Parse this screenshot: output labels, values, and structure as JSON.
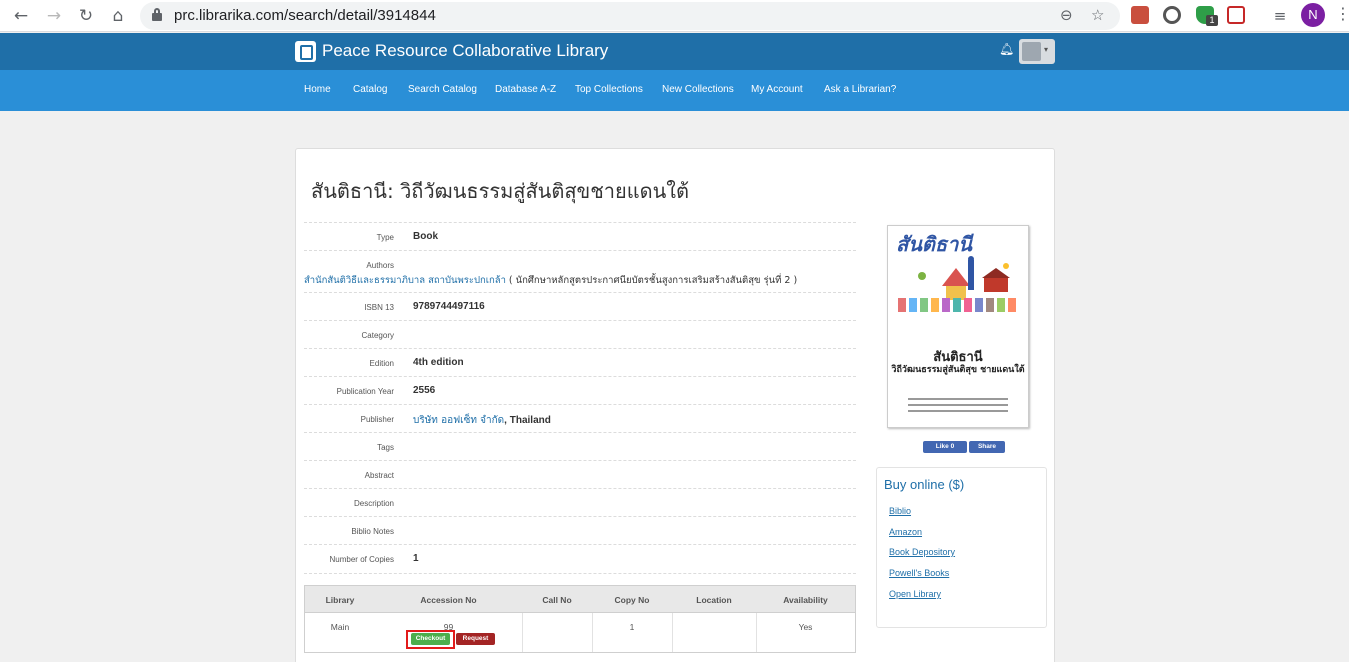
{
  "browser": {
    "url": "prc.librarika.com/search/detail/3914844",
    "profile_initial": "N",
    "extension_badge": "1"
  },
  "site": {
    "title": "Peace Resource Collaborative Library",
    "nav": [
      "Home",
      "Catalog",
      "Search Catalog",
      "Database A-Z",
      "Top Collections",
      "New Collections",
      "My Account",
      "Ask a Librarian?"
    ]
  },
  "book": {
    "title": "สันติธานี: วิถีวัฒนธรรมสู่สันติสุขชายแดนใต้",
    "type_label": "Type",
    "type": "Book",
    "authors_label": "Authors",
    "authors_link": "สำนักสันติวิธีและธรรมาภิบาล สถาบันพระปกเกล้า",
    "authors_extra": " ( นักศึกษาหลักสูตรประกาศนียบัตรชั้นสูงการเสริมสร้างสันติสุข รุ่นที่ 2 )",
    "isbn_label": "ISBN 13",
    "isbn": "9789744497116",
    "category_label": "Category",
    "edition_label": "Edition",
    "edition": "4th edition",
    "pubyear_label": "Publication Year",
    "pubyear": "2556",
    "publisher_label": "Publisher",
    "publisher_link": "บริษัท ออฟเซ็ท จำกัด",
    "publisher_extra": ", Thailand",
    "tags_label": "Tags",
    "abstract_label": "Abstract",
    "description_label": "Description",
    "biblio_label": "Biblio Notes",
    "copies_label": "Number of Copies",
    "copies": "1"
  },
  "holdings": {
    "headers": [
      "Library",
      "Accession No",
      "Call No",
      "Copy No",
      "Location",
      "Availability"
    ],
    "row": {
      "library": "Main",
      "accession": "99",
      "call_no": "",
      "copy_no": "1",
      "location": "",
      "availability": "Yes"
    },
    "checkout_label": "Checkout",
    "request_label": "Request"
  },
  "cover": {
    "title": "สันติธานี",
    "subtitle1": "สันติธานี",
    "subtitle2": "วิถีวัฒนธรรมสู่สันติสุข ชายแดนใต้"
  },
  "social": {
    "like_label": "Like 0",
    "share_label": "Share"
  },
  "buy": {
    "title": "Buy online ($)",
    "links": [
      "Biblio",
      "Amazon",
      "Book Depository",
      "Powell's Books",
      "Open Library"
    ]
  },
  "colors": {
    "header": "#1f6fa8",
    "nav": "#2a8fd7",
    "checkout": "#4cae4c",
    "request": "#a32424",
    "highlight": "#e21b1b"
  }
}
